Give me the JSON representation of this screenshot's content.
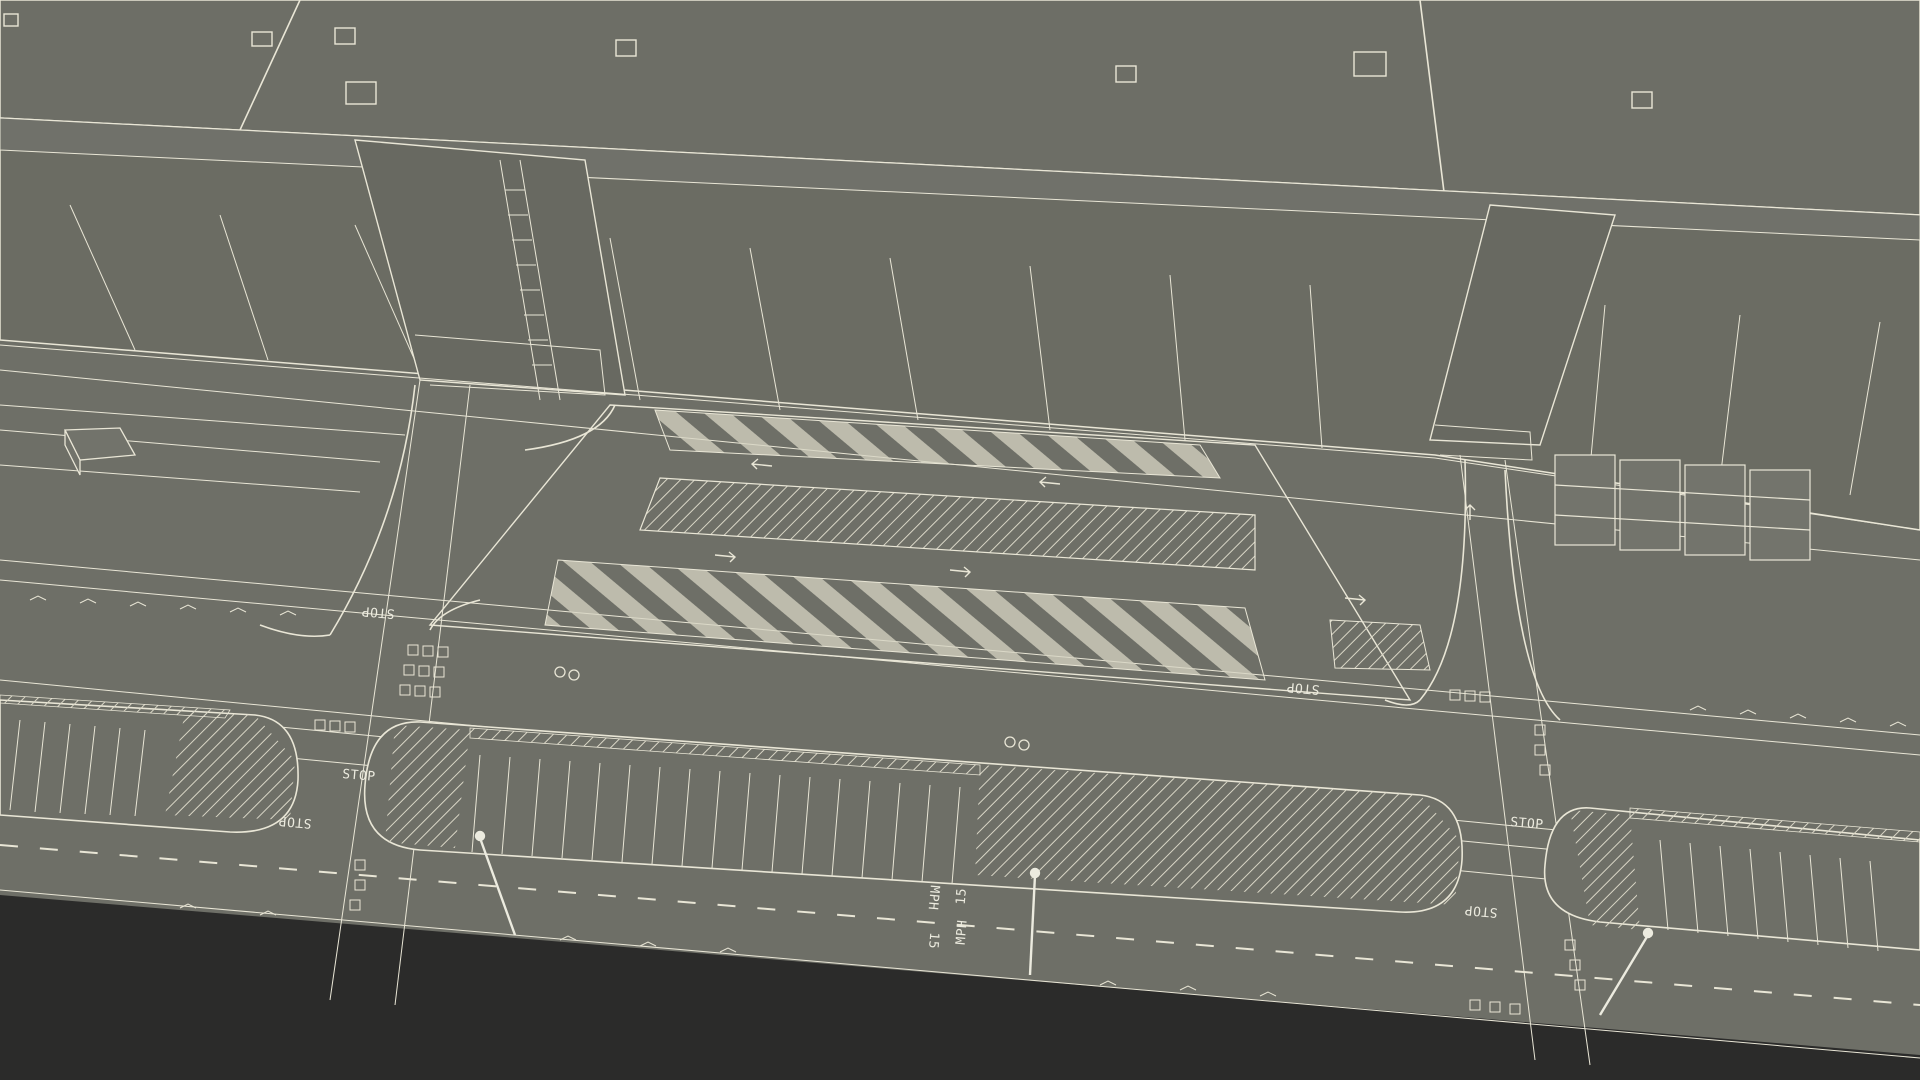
{
  "scene": {
    "colors": {
      "background": "#2b2b2a",
      "roof": "#6d6e66",
      "facade": "#6b6c63",
      "facade_shade": "#63645c",
      "ground": "#6e6f67",
      "lines": "#e9e6d6",
      "hatch": "#d9d6c6"
    },
    "road_markings": {
      "stop": "STOP",
      "mph": "MPH",
      "speed_limit": "15"
    },
    "icons": [
      "roof-vent-icon",
      "light-pole-icon",
      "arrow-left-icon",
      "arrow-right-icon",
      "arrow-up-icon",
      "bicycle-icon"
    ]
  }
}
